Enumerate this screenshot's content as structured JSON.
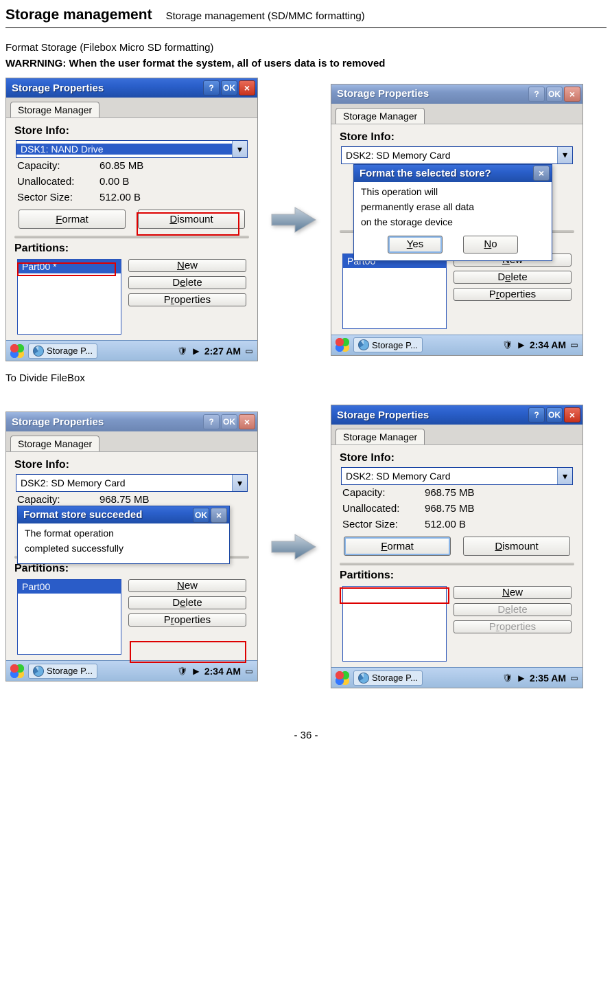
{
  "header": {
    "title": "Storage management",
    "subtitle": "Storage management (SD/MMC formatting)"
  },
  "intro": "Format Storage (Filebox Micro SD formatting)",
  "warning": "WARRNING: When the user format the system, all of users data is to removed",
  "common": {
    "window_title": "Storage Properties",
    "help_btn": "?",
    "ok_btn": "OK",
    "close_btn": "×",
    "tab": "Storage Manager",
    "store_info": "Store Info:",
    "capacity": "Capacity:",
    "unallocated": "Unallocated:",
    "sector": "Sector Size:",
    "format_btn": {
      "pre": "",
      "u": "F",
      "post": "ormat"
    },
    "dismount_btn": {
      "pre": "",
      "u": "D",
      "post": "ismount"
    },
    "partitions": "Partitions:",
    "new_btn": {
      "pre": "",
      "u": "N",
      "post": "ew"
    },
    "delete_btn": {
      "pre": "D",
      "u": "e",
      "post": "lete"
    },
    "properties_btn": {
      "pre": "P",
      "u": "r",
      "post": "operties"
    },
    "taskbar_label": "Storage P..."
  },
  "s1": {
    "store": "DSK1: NAND Drive",
    "capacity": "60.85 MB",
    "unallocated": "0.00 B",
    "sector": "512.00 B",
    "partition": "Part00 *",
    "time": "2:27 AM"
  },
  "s2": {
    "store": "DSK2: SD Memory Card",
    "dialog_title": "Format the selected store?",
    "dialog_text1": "This operation will",
    "dialog_text2": "permanently erase all data",
    "dialog_text3": "on the storage device",
    "yes": {
      "u": "Y",
      "post": "es"
    },
    "no": {
      "u": "N",
      "post": "o"
    },
    "partition": "Part00",
    "time": "2:34 AM"
  },
  "between": "To Divide FileBox",
  "s3": {
    "store": "DSK2: SD Memory Card",
    "capacity": "968.75 MB",
    "dialog_title": "Format store succeeded",
    "dialog_text1": "The format operation",
    "dialog_text2": "completed successfully",
    "partition": "Part00",
    "time": "2:34 AM"
  },
  "s4": {
    "store": "DSK2: SD Memory Card",
    "capacity": "968.75 MB",
    "unallocated": "968.75 MB",
    "sector": "512.00 B",
    "time": "2:35 AM"
  },
  "footer": "- 36 -"
}
